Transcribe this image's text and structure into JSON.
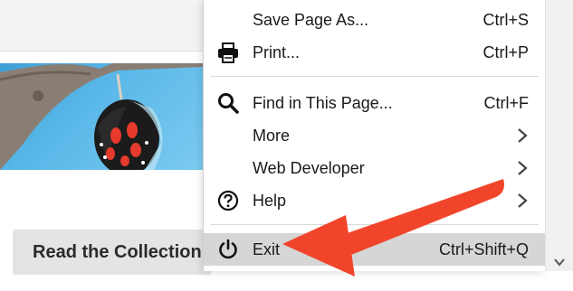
{
  "menu": {
    "items": [
      {
        "label": "Save Page As...",
        "shortcut": "Ctrl+S"
      },
      {
        "label": "Print...",
        "shortcut": "Ctrl+P",
        "icon": "printer-icon"
      },
      {
        "label": "Find in This Page...",
        "shortcut": "Ctrl+F",
        "icon": "search-icon"
      },
      {
        "label": "More"
      },
      {
        "label": "Web Developer"
      },
      {
        "label": "Help",
        "icon": "help-icon"
      },
      {
        "label": "Exit",
        "shortcut": "Ctrl+Shift+Q",
        "icon": "power-icon"
      }
    ]
  },
  "page": {
    "button_label": "Read the Collection"
  },
  "colors": {
    "annotation_arrow": "#f0452a",
    "menu_hover": "#d6d6d6"
  }
}
